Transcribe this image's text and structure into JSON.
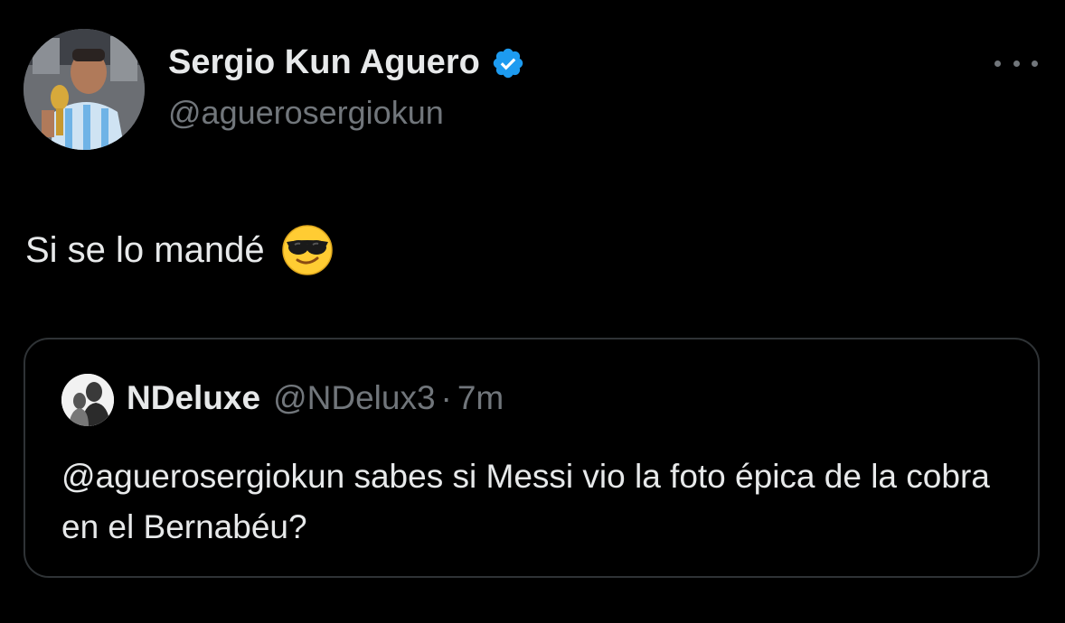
{
  "author": {
    "display_name": "Sergio Kun Aguero",
    "handle": "@aguerosergiokun",
    "verified_icon": "verified-badge-icon",
    "verified_color": "#1d9bf0",
    "avatar": "profile-photo"
  },
  "more_icon": "more-options-icon",
  "tweet": {
    "text": "Si se lo mandé",
    "emoji": "smiling-face-with-sunglasses"
  },
  "quoted": {
    "display_name": "NDeluxe",
    "handle": "@NDelux3",
    "separator": "·",
    "time": "7m",
    "text": "@aguerosergiokun sabes si Messi vio la foto épica de la cobra en el Bernabéu?",
    "avatar": "profile-photo"
  },
  "colors": {
    "background": "#000000",
    "primary_text": "#e7e9ea",
    "secondary_text": "#71767b",
    "border": "#2f3336"
  }
}
